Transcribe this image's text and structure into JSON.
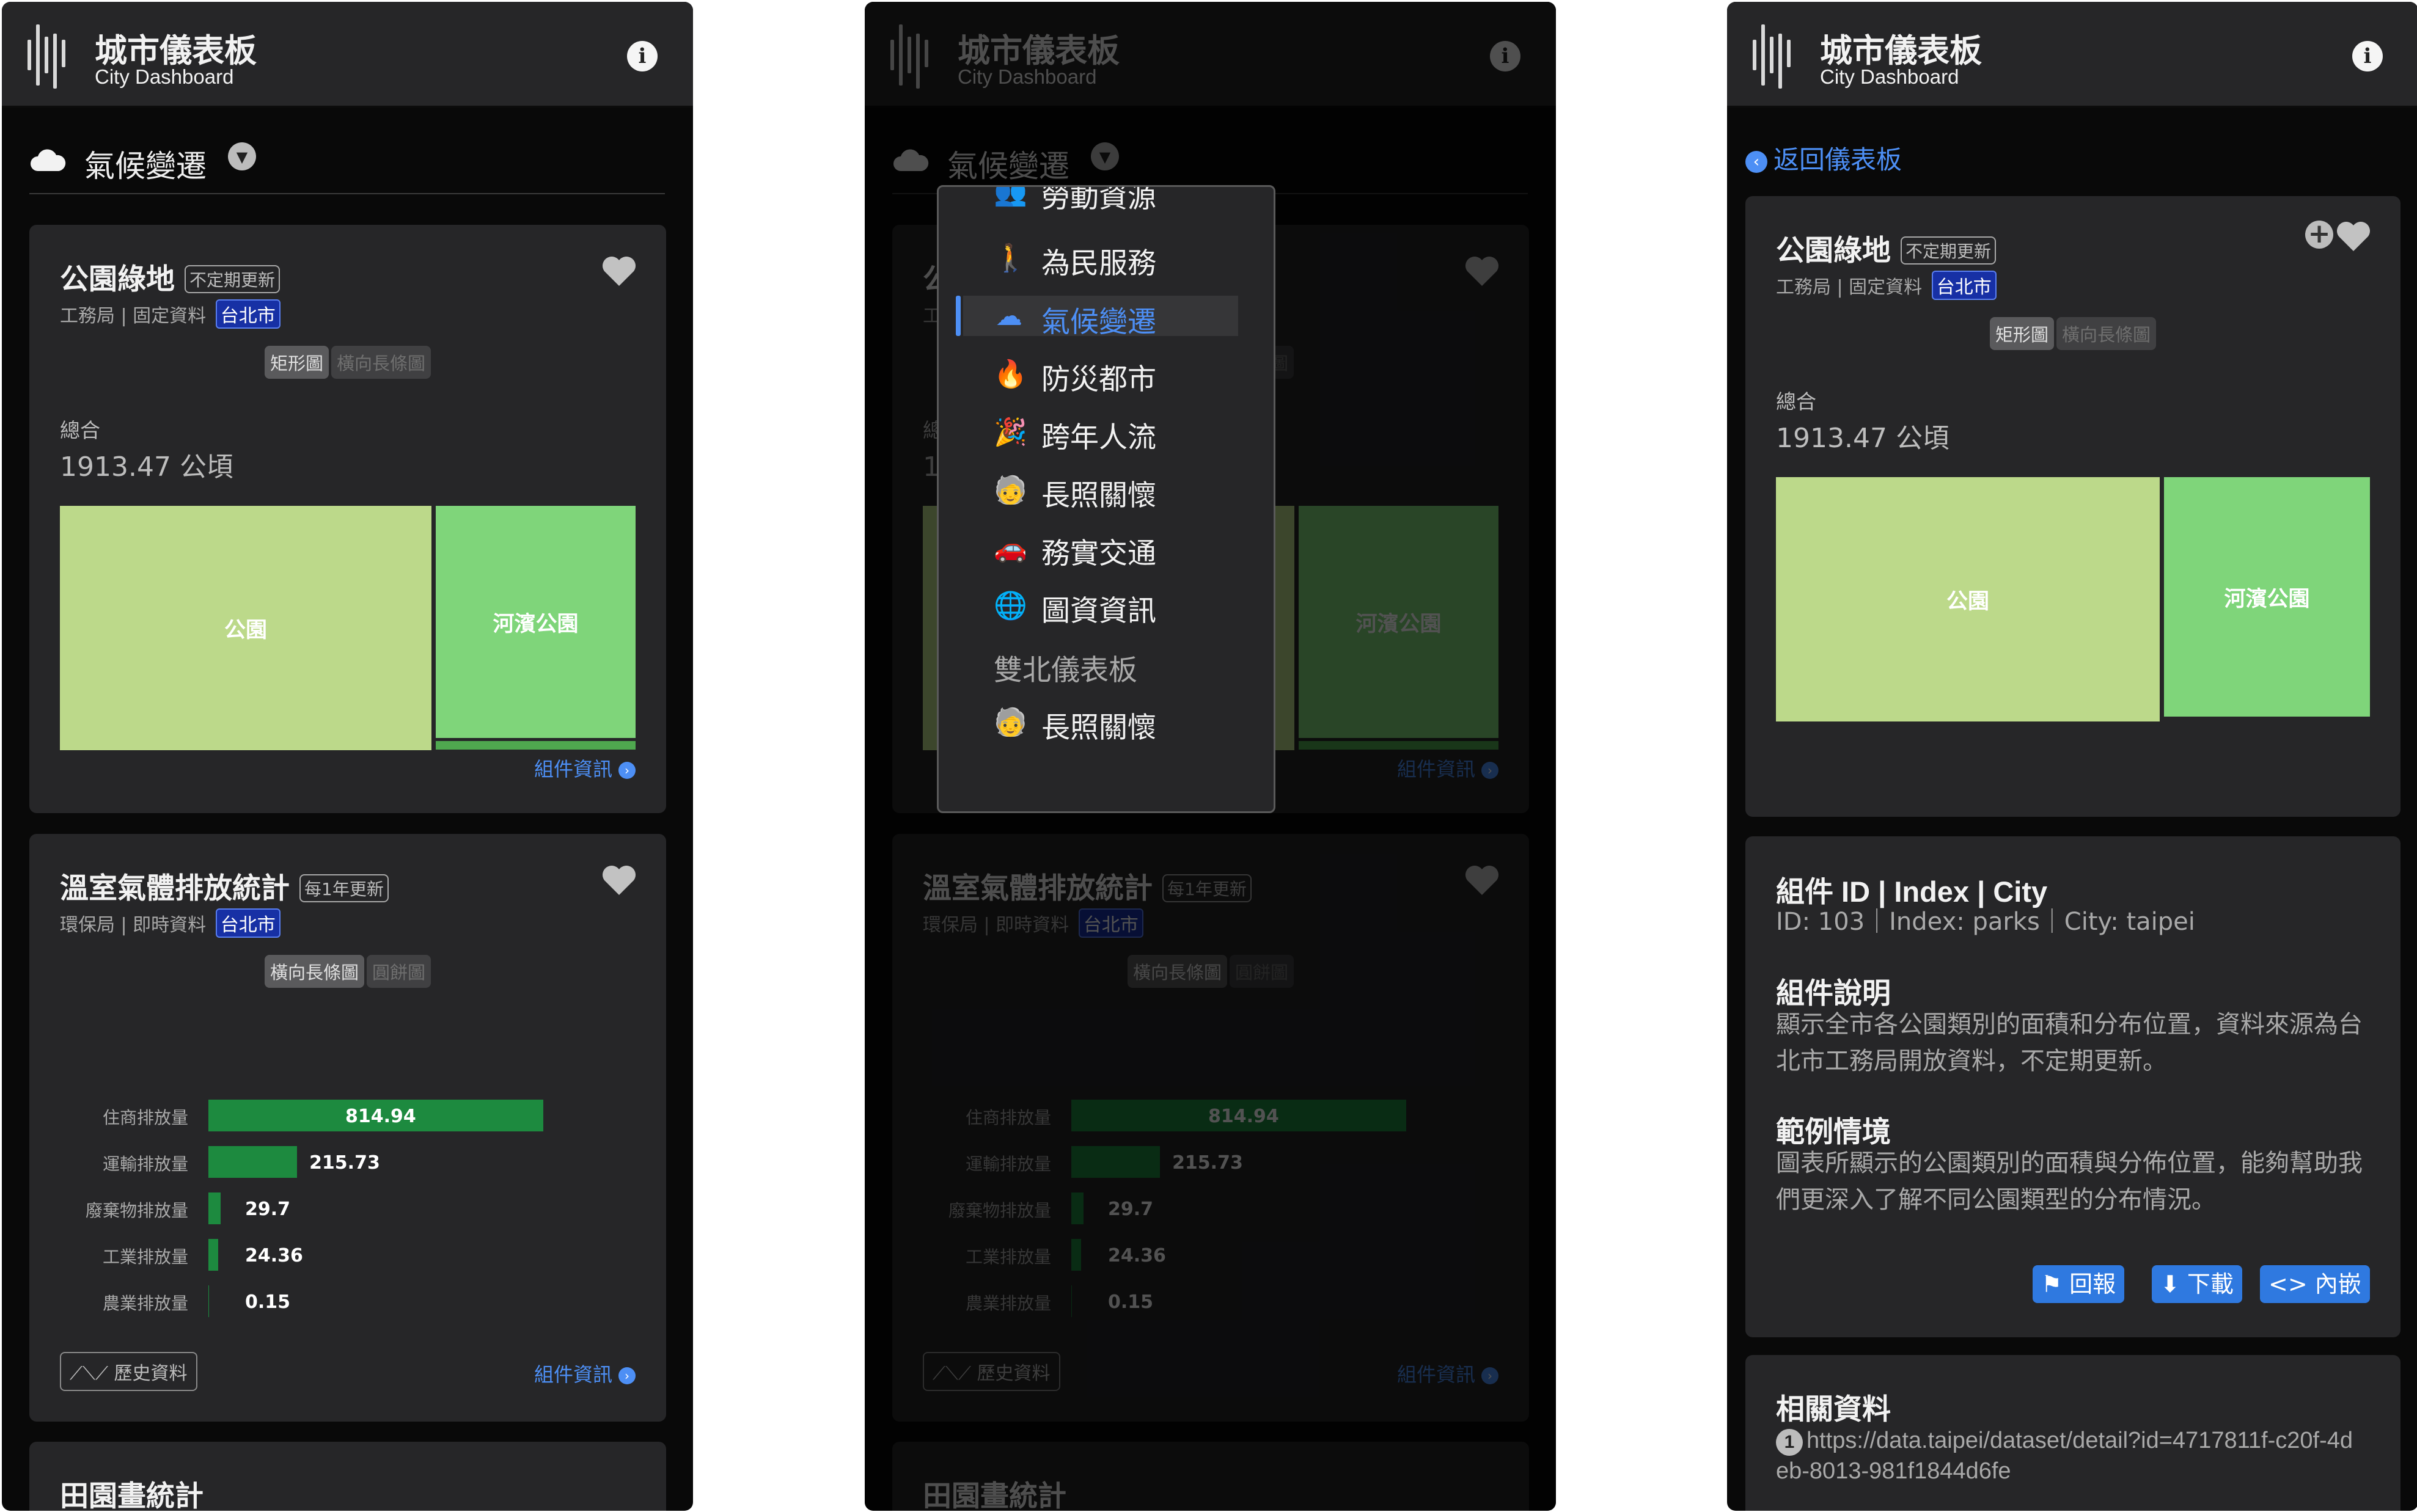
{
  "header": {
    "title": "城市儀表板",
    "subtitle": "City Dashboard"
  },
  "topic": {
    "label": "氣候變遷"
  },
  "cards": {
    "parks": {
      "title": "公園綠地",
      "tag": "不定期更新",
      "meta": "工務局 | 固定資料",
      "city": "台北市",
      "tabs": [
        "矩形圖",
        "橫向長條圖"
      ],
      "sum_label": "總合",
      "sum_value": "1913.47 公頃",
      "treemap": [
        {
          "label": "公園"
        },
        {
          "label": "河濱公園"
        }
      ],
      "link": "組件資訊"
    },
    "ghg": {
      "title": "溫室氣體排放統計",
      "tag": "每1年更新",
      "meta": "環保局 | 即時資料",
      "city": "台北市",
      "tabs": [
        "橫向長條圖",
        "圓餅圖"
      ],
      "history": "歷史資料",
      "link": "組件資訊"
    },
    "next": {
      "title": "田園畫統計"
    }
  },
  "chart_data": {
    "type": "bar",
    "orientation": "horizontal",
    "categories": [
      "住商排放量",
      "運輸排放量",
      "廢棄物排放量",
      "工業排放量",
      "農業排放量"
    ],
    "values": [
      814.94,
      215.73,
      29.7,
      24.36,
      0.15
    ],
    "value_labels": [
      "814.94",
      "215.73",
      "29.7",
      "24.36",
      "0.15"
    ],
    "color": "#1d8a3f"
  },
  "dropdown": {
    "items": [
      {
        "label": "勞動資源",
        "icon": "users-icon"
      },
      {
        "label": "為民服務",
        "icon": "service-icon"
      },
      {
        "label": "氣候變遷",
        "icon": "cloud-icon",
        "selected": true
      },
      {
        "label": "防災都市",
        "icon": "fire-icon"
      },
      {
        "label": "跨年人流",
        "icon": "party-icon"
      },
      {
        "label": "長照關懷",
        "icon": "elderly-icon"
      },
      {
        "label": "務實交通",
        "icon": "car-icon"
      },
      {
        "label": "圖資資訊",
        "icon": "globe-icon"
      }
    ],
    "group_header": "雙北儀表板",
    "group_items": [
      {
        "label": "長照關懷",
        "icon": "elderly-icon"
      }
    ]
  },
  "detail": {
    "back": "返回儀表板",
    "id_title": "組件 ID | Index | City",
    "id_text": "ID: 103｜Index: parks｜City: taipei",
    "desc_title": "組件說明",
    "desc_text": "顯示全市各公園類別的面積和分布位置，資料來源為台北市工務局開放資料，不定期更新。",
    "scenario_title": "範例情境",
    "scenario_text": "圖表所顯示的公園類別的面積與分佈位置，能夠幫助我們更深入了解不同公園類型的分布情況。",
    "buttons": {
      "report": "回報",
      "download": "下載",
      "embed": "內嵌"
    },
    "related_title": "相關資料",
    "related_index": "1",
    "related_url": "https://data.taipei/dataset/detail?id=4717811f-c20f-4deb-8013-981f1844d6fe"
  },
  "colors": {
    "accent": "#4d8ff5",
    "park": "#bcd98a",
    "riverside_park": "#7fd57a",
    "bar": "#1d8a3f"
  }
}
